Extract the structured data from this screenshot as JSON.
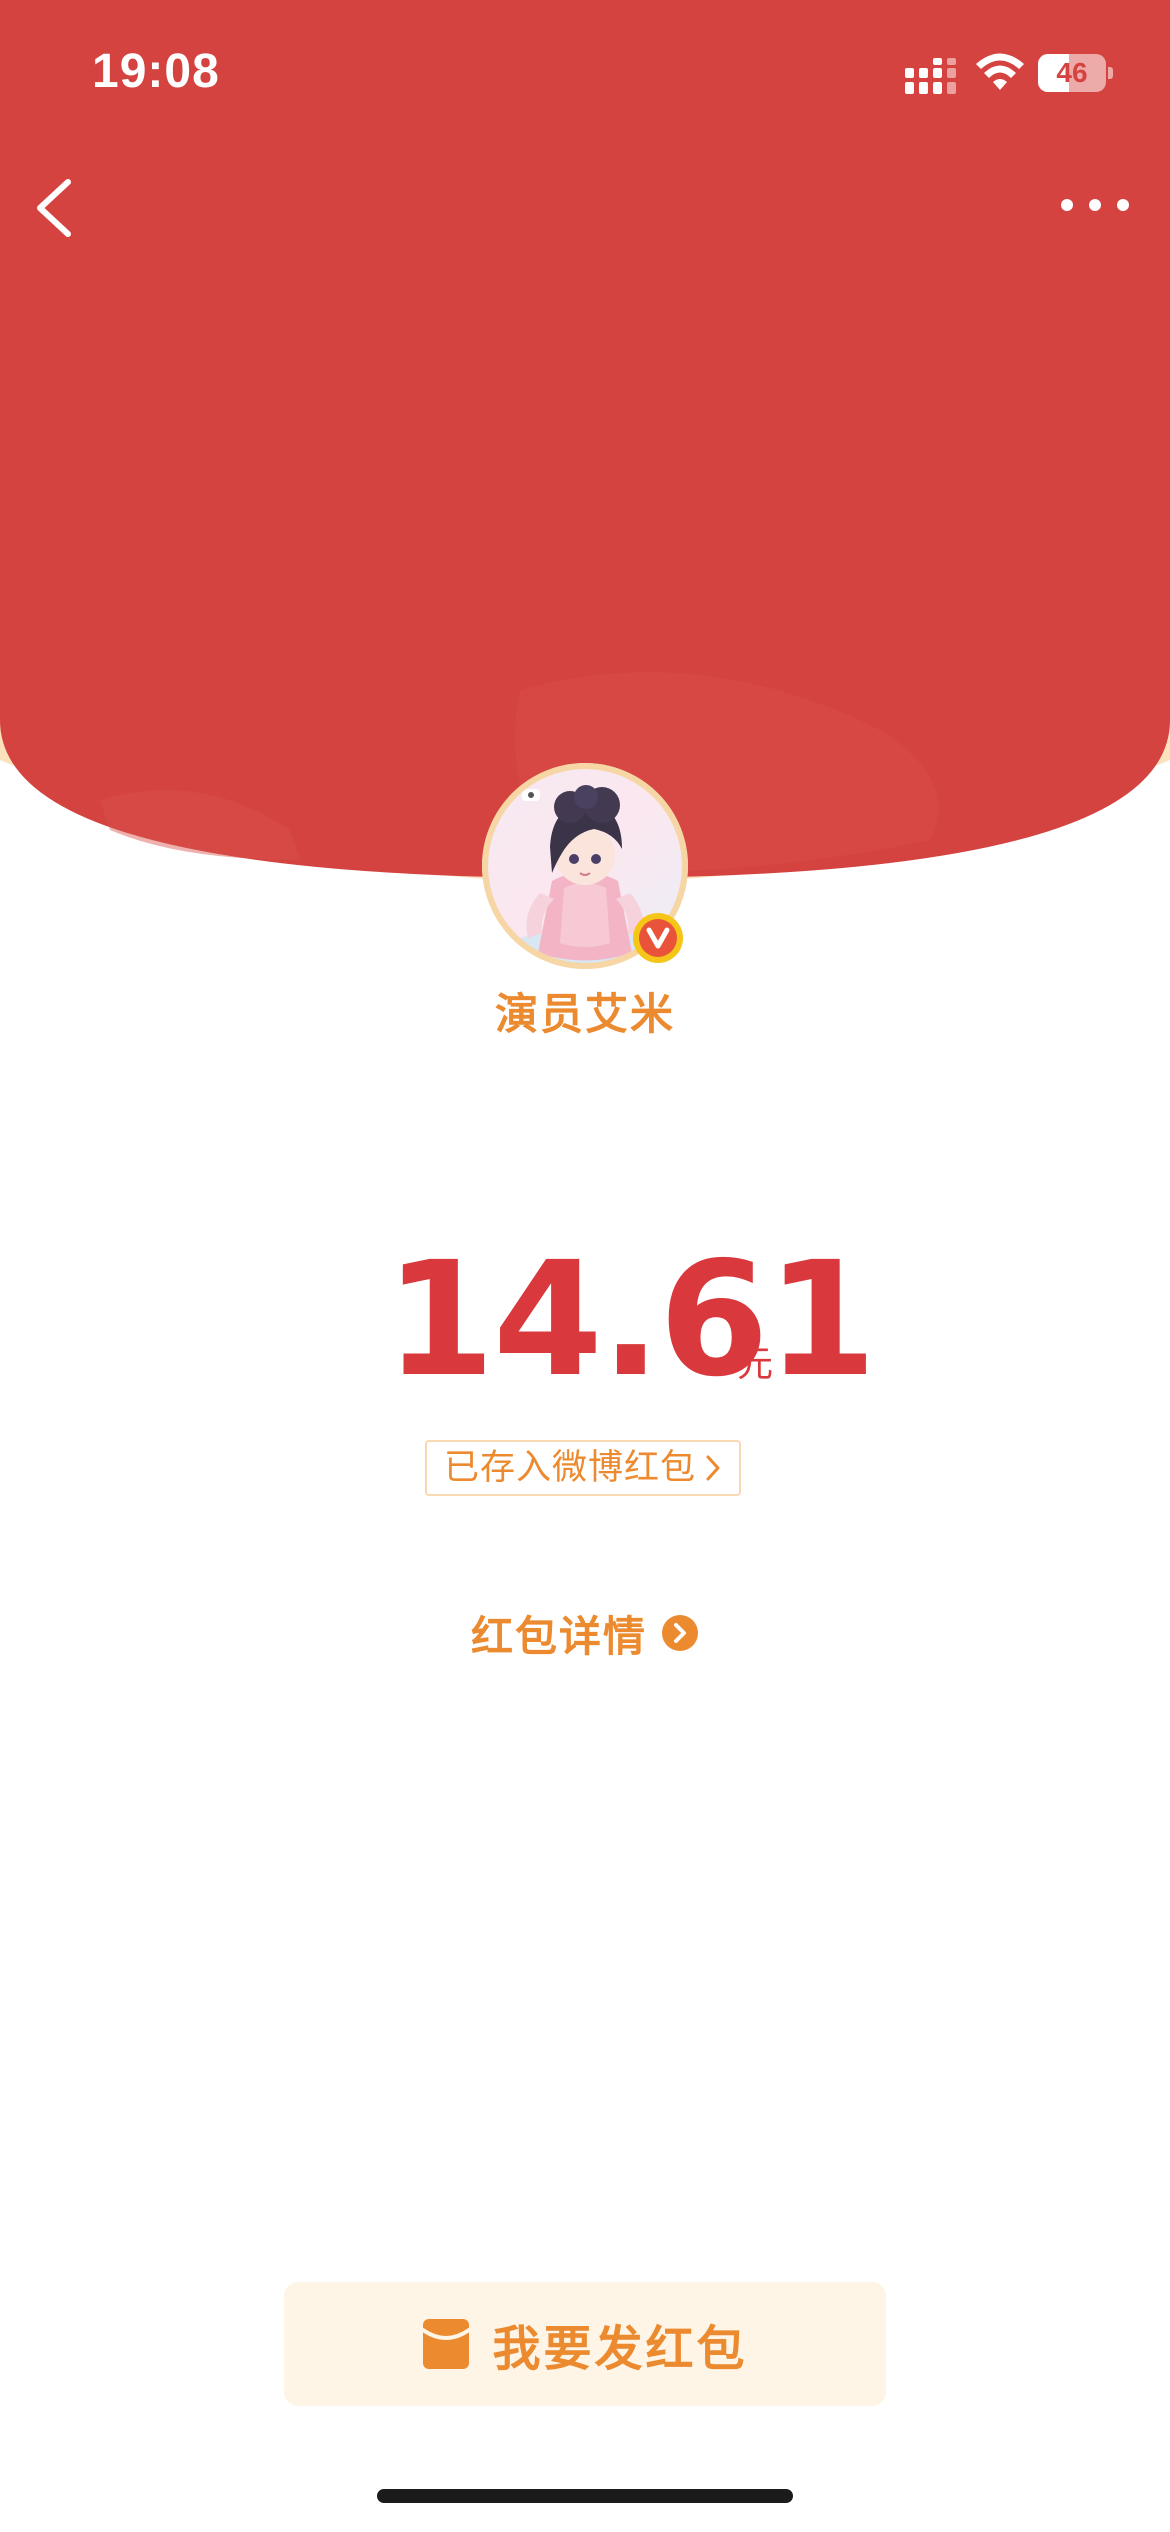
{
  "status_bar": {
    "time": "19:08",
    "battery_level": "46",
    "battery_percent": 46,
    "signal_icon": "cellular-signal-icon",
    "wifi_icon": "wifi-icon"
  },
  "nav": {
    "back_icon": "chevron-left-icon",
    "more_icon": "more-dots-icon"
  },
  "sender": {
    "name": "演员艾米",
    "verified_icon": "verified-v-badge-icon"
  },
  "amount": {
    "value": "14.61",
    "unit": "元"
  },
  "stored_tag": {
    "label": "已存入微博红包"
  },
  "details": {
    "label": "红包详情"
  },
  "send_button": {
    "label": "我要发红包",
    "icon": "red-envelope-icon"
  },
  "colors": {
    "header_red": "#d44340",
    "rim_cream": "#fbe2bd",
    "accent_orange": "#ec8a2f",
    "amount_red": "#d9393c",
    "button_bg": "#fef5e6"
  }
}
